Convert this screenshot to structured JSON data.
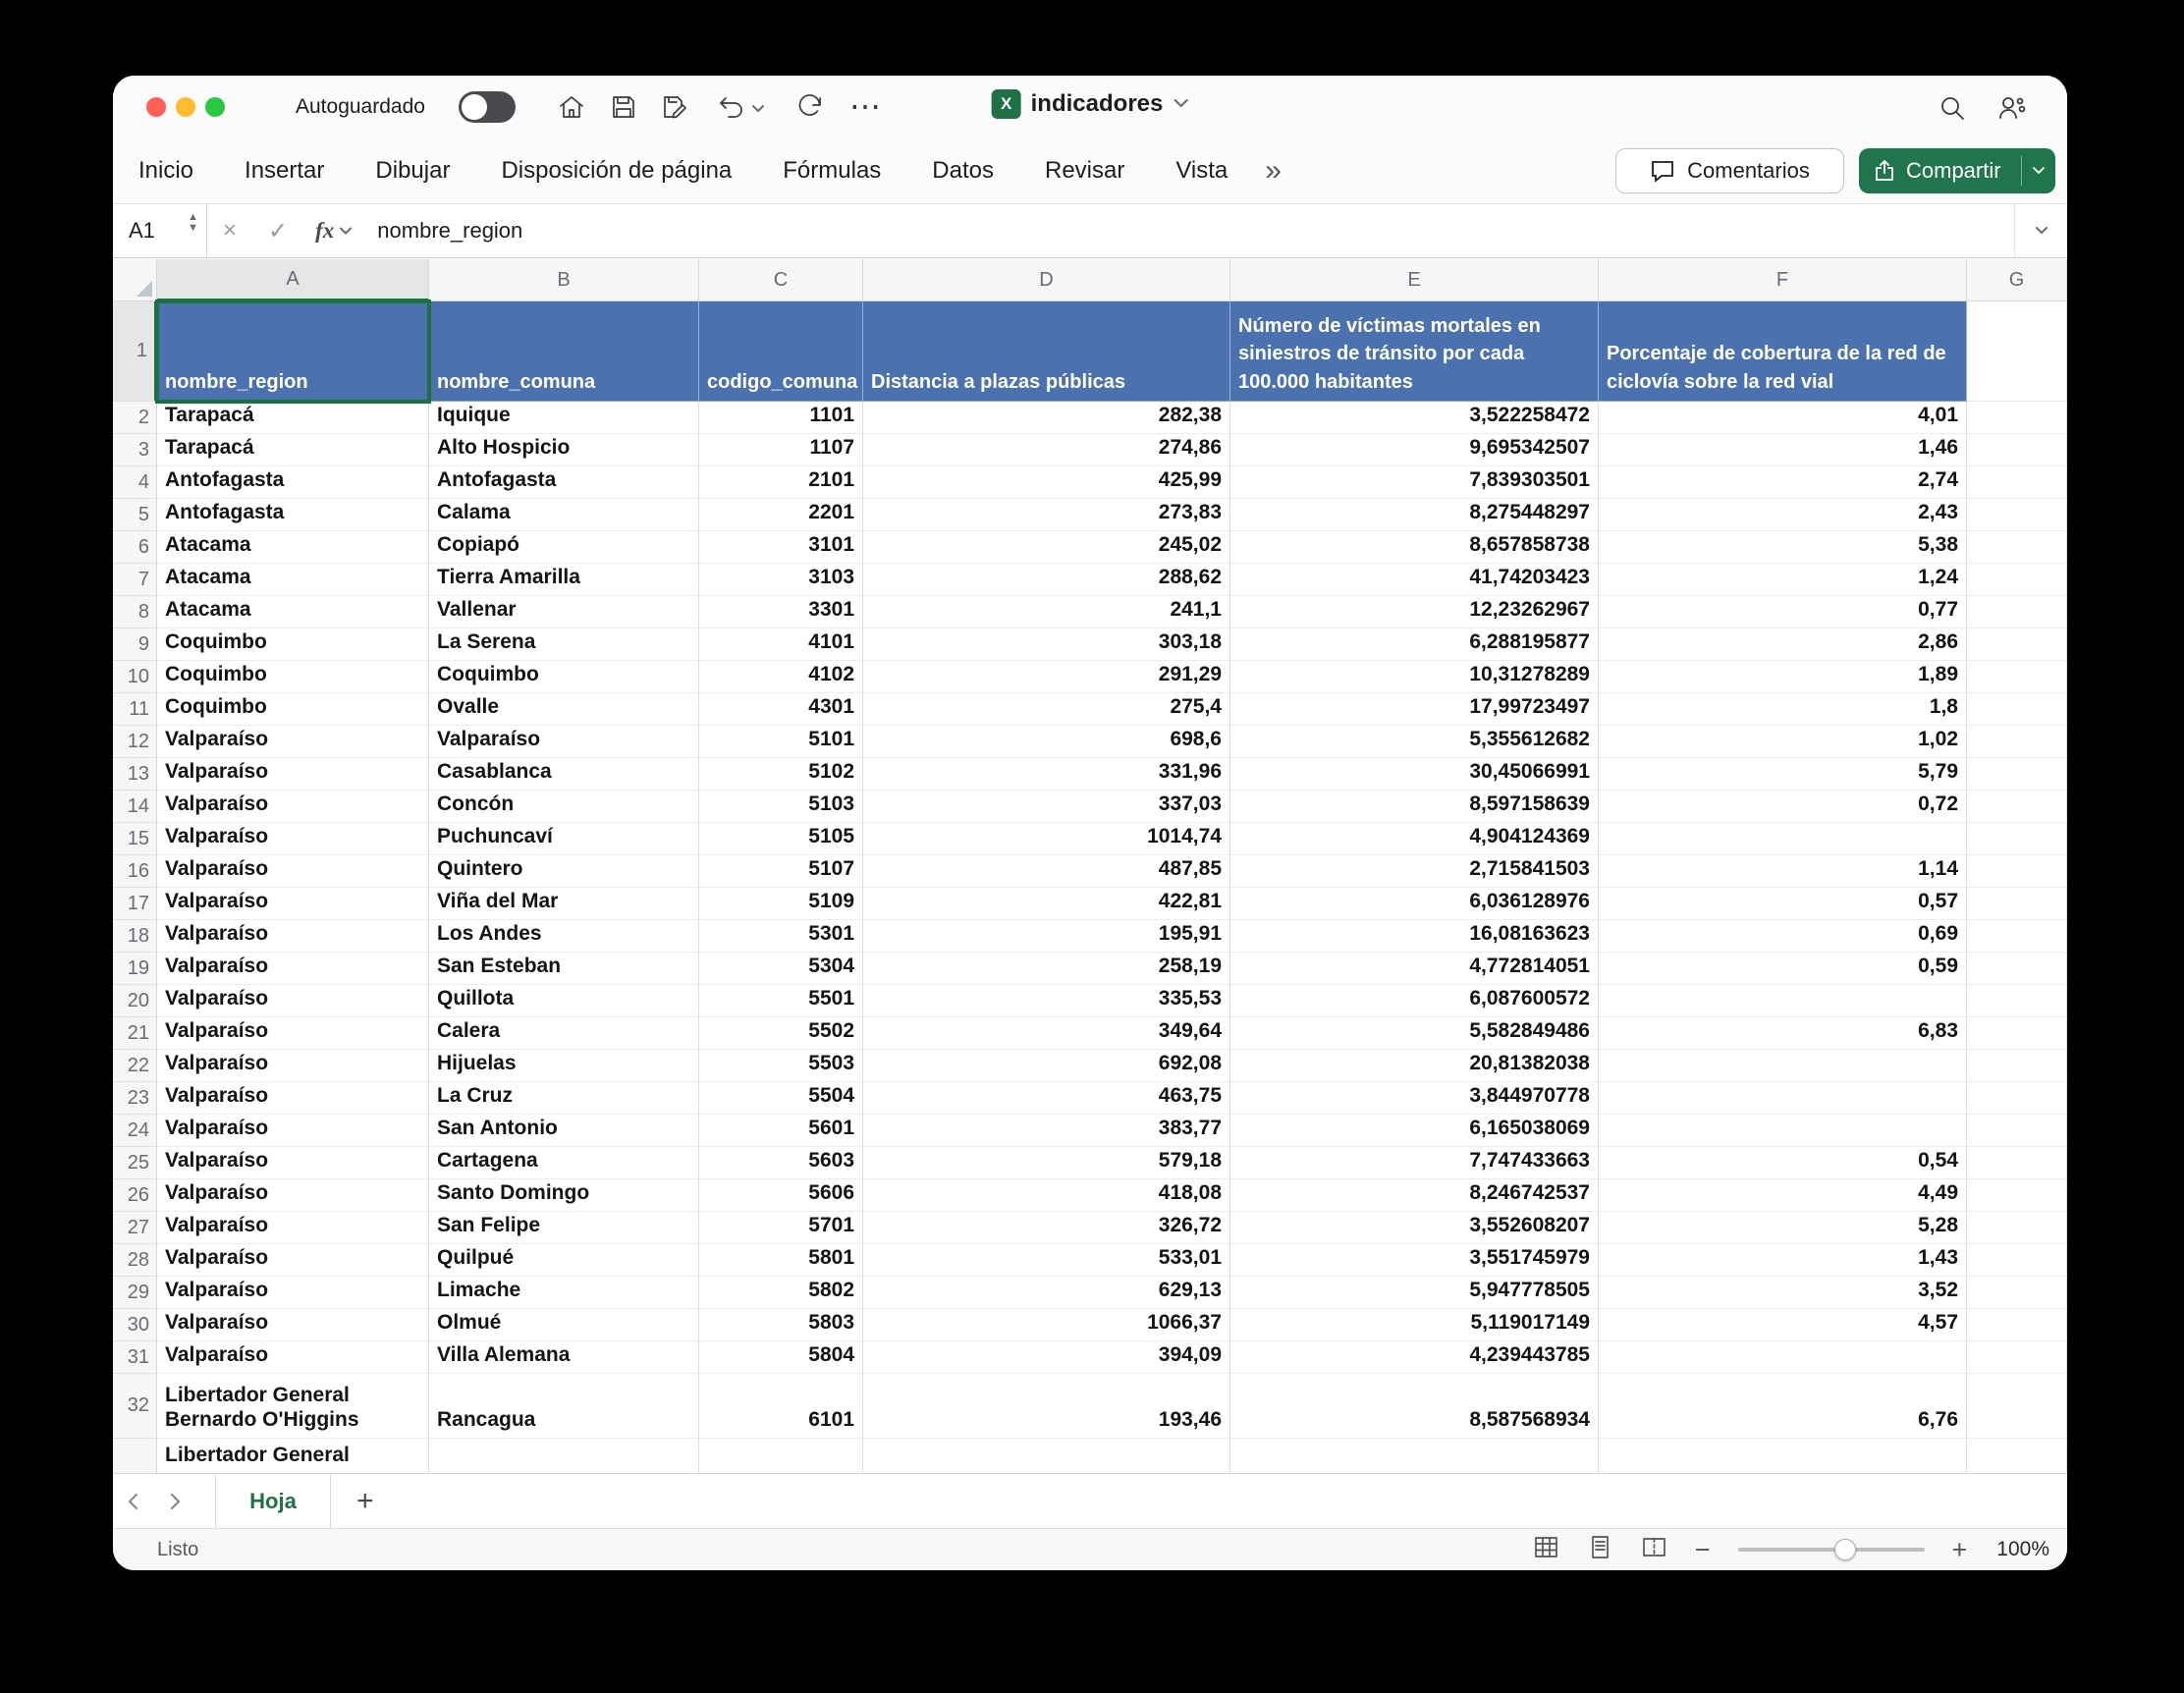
{
  "colors": {
    "accent_green": "#217346",
    "header_blue": "#4b72ae",
    "selection_green": "#1d7044",
    "traffic_red": "#ff5f57",
    "traffic_yellow": "#febc2e",
    "traffic_green": "#28c840"
  },
  "icons": {
    "ellipsis": "⋯",
    "cancel": "×",
    "confirm": "✓",
    "stepper_up": "▲",
    "stepper_down": "▼",
    "more_tabs": "»",
    "add_sheet": "+",
    "zoom_minus": "−",
    "zoom_plus": "+",
    "excel_logo": "X"
  },
  "titlebar": {
    "autosave_label": "Autoguardado",
    "doc_title": "indicadores"
  },
  "ribbon": {
    "tabs": [
      "Inicio",
      "Insertar",
      "Dibujar",
      "Disposición de página",
      "Fórmulas",
      "Datos",
      "Revisar",
      "Vista"
    ],
    "comments_label": "Comentarios",
    "share_label": "Compartir"
  },
  "formula_bar": {
    "cell_reference": "A1",
    "fx_label": "fx",
    "formula_value": "nombre_region"
  },
  "grid": {
    "column_letters": [
      "A",
      "B",
      "C",
      "D",
      "E",
      "F",
      "G"
    ],
    "selected_column": "A",
    "selected_row": 1,
    "selected_cell": "A1",
    "headers": [
      "nombre_region",
      "nombre_comuna",
      "codigo_comuna",
      "Distancia a plazas públicas",
      "Número de víctimas mortales en siniestros de tránsito por cada 100.000 habitantes",
      "Porcentaje de cobertura de la red de ciclovía sobre la red vial"
    ],
    "rows": [
      {
        "n": 2,
        "cells": [
          "Tarapacá",
          "Iquique",
          "1101",
          "282,38",
          "3,522258472",
          "4,01"
        ]
      },
      {
        "n": 3,
        "cells": [
          "Tarapacá",
          "Alto Hospicio",
          "1107",
          "274,86",
          "9,695342507",
          "1,46"
        ]
      },
      {
        "n": 4,
        "cells": [
          "Antofagasta",
          "Antofagasta",
          "2101",
          "425,99",
          "7,839303501",
          "2,74"
        ]
      },
      {
        "n": 5,
        "cells": [
          "Antofagasta",
          "Calama",
          "2201",
          "273,83",
          "8,275448297",
          "2,43"
        ]
      },
      {
        "n": 6,
        "cells": [
          "Atacama",
          "Copiapó",
          "3101",
          "245,02",
          "8,657858738",
          "5,38"
        ]
      },
      {
        "n": 7,
        "cells": [
          "Atacama",
          "Tierra Amarilla",
          "3103",
          "288,62",
          "41,74203423",
          "1,24"
        ]
      },
      {
        "n": 8,
        "cells": [
          "Atacama",
          "Vallenar",
          "3301",
          "241,1",
          "12,23262967",
          "0,77"
        ]
      },
      {
        "n": 9,
        "cells": [
          "Coquimbo",
          "La Serena",
          "4101",
          "303,18",
          "6,288195877",
          "2,86"
        ]
      },
      {
        "n": 10,
        "cells": [
          "Coquimbo",
          "Coquimbo",
          "4102",
          "291,29",
          "10,31278289",
          "1,89"
        ]
      },
      {
        "n": 11,
        "cells": [
          "Coquimbo",
          "Ovalle",
          "4301",
          "275,4",
          "17,99723497",
          "1,8"
        ]
      },
      {
        "n": 12,
        "cells": [
          "Valparaíso",
          "Valparaíso",
          "5101",
          "698,6",
          "5,355612682",
          "1,02"
        ]
      },
      {
        "n": 13,
        "cells": [
          "Valparaíso",
          "Casablanca",
          "5102",
          "331,96",
          "30,45066991",
          "5,79"
        ]
      },
      {
        "n": 14,
        "cells": [
          "Valparaíso",
          "Concón",
          "5103",
          "337,03",
          "8,597158639",
          "0,72"
        ]
      },
      {
        "n": 15,
        "cells": [
          "Valparaíso",
          "Puchuncaví",
          "5105",
          "1014,74",
          "4,904124369",
          ""
        ]
      },
      {
        "n": 16,
        "cells": [
          "Valparaíso",
          "Quintero",
          "5107",
          "487,85",
          "2,715841503",
          "1,14"
        ]
      },
      {
        "n": 17,
        "cells": [
          "Valparaíso",
          "Viña del Mar",
          "5109",
          "422,81",
          "6,036128976",
          "0,57"
        ]
      },
      {
        "n": 18,
        "cells": [
          "Valparaíso",
          "Los Andes",
          "5301",
          "195,91",
          "16,08163623",
          "0,69"
        ]
      },
      {
        "n": 19,
        "cells": [
          "Valparaíso",
          "San Esteban",
          "5304",
          "258,19",
          "4,772814051",
          "0,59"
        ]
      },
      {
        "n": 20,
        "cells": [
          "Valparaíso",
          "Quillota",
          "5501",
          "335,53",
          "6,087600572",
          ""
        ]
      },
      {
        "n": 21,
        "cells": [
          "Valparaíso",
          "Calera",
          "5502",
          "349,64",
          "5,582849486",
          "6,83"
        ]
      },
      {
        "n": 22,
        "cells": [
          "Valparaíso",
          "Hijuelas",
          "5503",
          "692,08",
          "20,81382038",
          ""
        ]
      },
      {
        "n": 23,
        "cells": [
          "Valparaíso",
          "La Cruz",
          "5504",
          "463,75",
          "3,844970778",
          ""
        ]
      },
      {
        "n": 24,
        "cells": [
          "Valparaíso",
          "San Antonio",
          "5601",
          "383,77",
          "6,165038069",
          ""
        ]
      },
      {
        "n": 25,
        "cells": [
          "Valparaíso",
          "Cartagena",
          "5603",
          "579,18",
          "7,747433663",
          "0,54"
        ]
      },
      {
        "n": 26,
        "cells": [
          "Valparaíso",
          "Santo Domingo",
          "5606",
          "418,08",
          "8,246742537",
          "4,49"
        ]
      },
      {
        "n": 27,
        "cells": [
          "Valparaíso",
          "San Felipe",
          "5701",
          "326,72",
          "3,552608207",
          "5,28"
        ]
      },
      {
        "n": 28,
        "cells": [
          "Valparaíso",
          "Quilpué",
          "5801",
          "533,01",
          "3,551745979",
          "1,43"
        ]
      },
      {
        "n": 29,
        "cells": [
          "Valparaíso",
          "Limache",
          "5802",
          "629,13",
          "5,947778505",
          "3,52"
        ]
      },
      {
        "n": 30,
        "cells": [
          "Valparaíso",
          "Olmué",
          "5803",
          "1066,37",
          "5,119017149",
          "4,57"
        ]
      },
      {
        "n": 31,
        "cells": [
          "Valparaíso",
          "Villa Alemana",
          "5804",
          "394,09",
          "4,239443785",
          ""
        ]
      },
      {
        "n": 32,
        "cells": [
          "Libertador General\nBernardo O'Higgins",
          "Rancagua",
          "6101",
          "193,46",
          "8,587568934",
          "6,76"
        ]
      }
    ],
    "partial_row": {
      "text": "Libertador General"
    }
  },
  "sheet_bar": {
    "tab_label": "Hoja"
  },
  "status_bar": {
    "status_label": "Listo",
    "zoom_label": "100%"
  }
}
